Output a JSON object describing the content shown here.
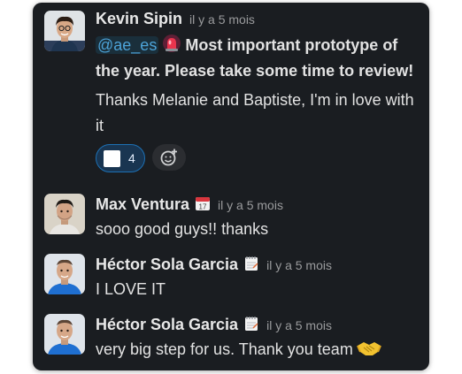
{
  "messages": [
    {
      "author": "Kevin Sipin",
      "timestamp": "il y a 5 mois",
      "mention": "@ae_es",
      "lead_text": "Most important prototype of the year. Please take some time to review!",
      "body": "Thanks Melanie and Baptiste, I'm in love with it",
      "reaction_count": "4",
      "avatar_icon": "kevin-avatar",
      "emoji": "rotating-light-icon"
    },
    {
      "author": "Max Ventura",
      "timestamp": "il y a 5 mois",
      "body": "sooo good guys!! thanks",
      "status_icon": "calendar-icon",
      "status_text": "17"
    },
    {
      "author": "Héctor Sola Garcia",
      "timestamp": "il y a 5 mois",
      "body": "I LOVE IT",
      "status_icon": "spiral-notepad-icon"
    },
    {
      "author": "Héctor Sola Garcia",
      "timestamp": "il y a 5 mois",
      "body": "very big step for us. Thank you team",
      "status_icon": "spiral-notepad-icon",
      "trailing_emoji": "handshake-icon"
    }
  ],
  "colors": {
    "panel_bg": "#1a1d21",
    "mention": "#4da3d8",
    "reaction_border": "#1d70b4"
  }
}
